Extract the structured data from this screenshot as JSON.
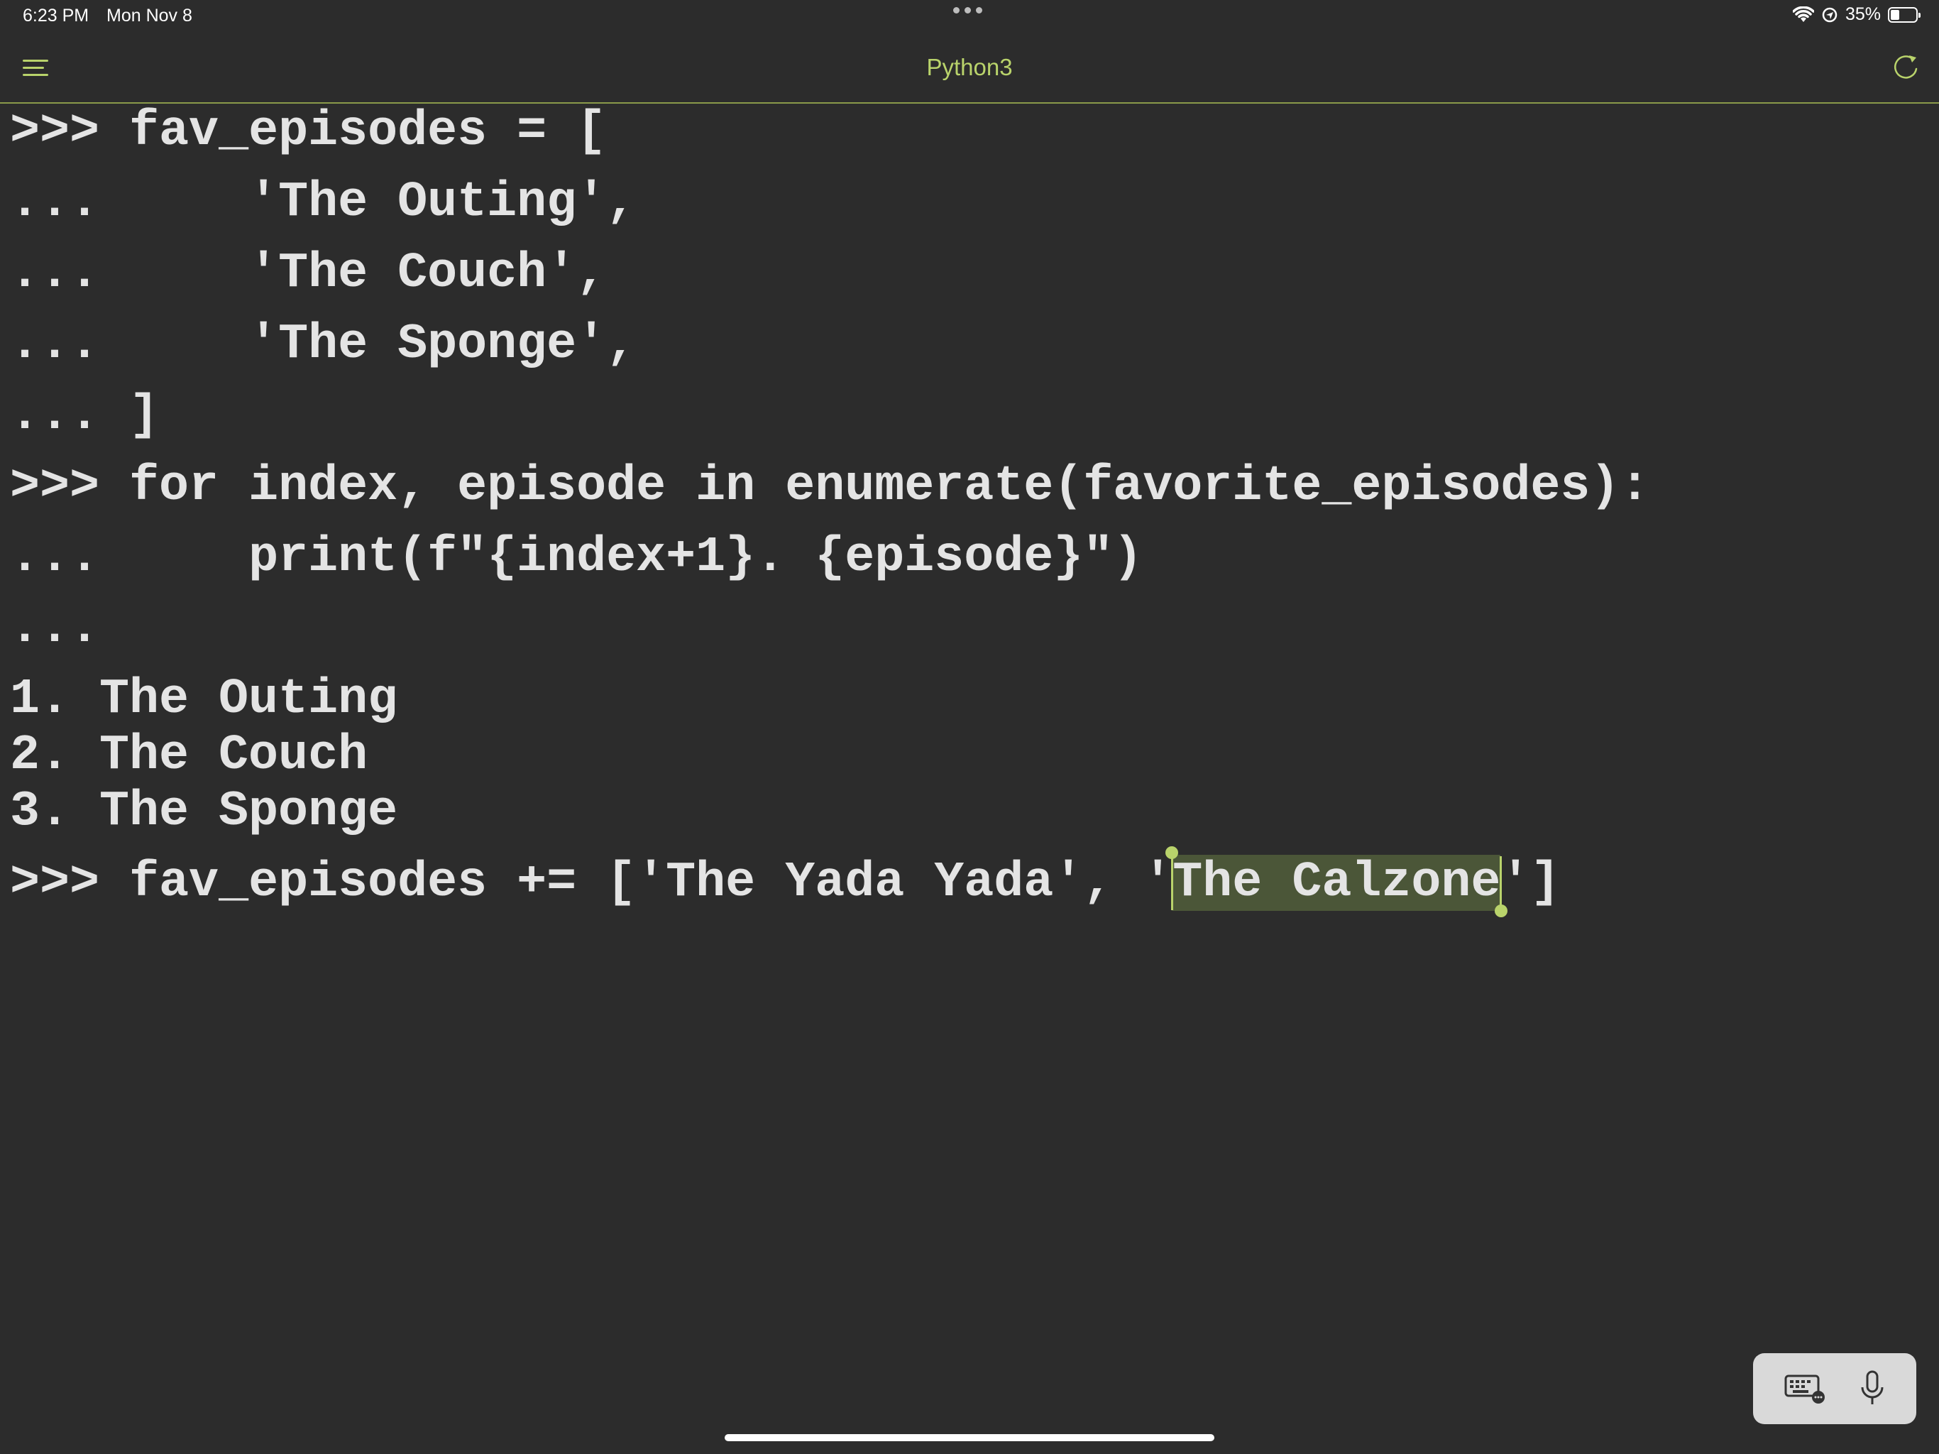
{
  "status_bar": {
    "time": "6:23 PM",
    "date": "Mon Nov 8",
    "battery_text": "35%",
    "battery_level": 0.35,
    "icons": [
      "wifi-icon",
      "location-icon",
      "battery-icon",
      "more-dots-icon"
    ]
  },
  "nav": {
    "title": "Python3",
    "menu_icon": "menu-icon",
    "refresh_icon": "refresh-icon",
    "accent_color": "#b9d36b"
  },
  "terminal": {
    "lines": [
      {
        "prompt": ">>>",
        "code": "fav_episodes = ["
      },
      {
        "prompt": "...",
        "code": "    'The Outing',"
      },
      {
        "prompt": "...",
        "code": "    'The Couch',"
      },
      {
        "prompt": "...",
        "code": "    'The Sponge',"
      },
      {
        "prompt": "...",
        "code": "]"
      },
      {
        "prompt": ">>>",
        "code": "for index, episode in enumerate(favorite_episodes):"
      },
      {
        "prompt": "...",
        "code": "    print(f\"{index+1}. {episode}\")"
      },
      {
        "prompt": "...",
        "code": ""
      }
    ],
    "output": [
      "1. The Outing",
      "2. The Couch",
      "3. The Sponge"
    ],
    "current_input": {
      "prompt": ">>>",
      "before_selection": "fav_episodes += ['The Yada Yada', '",
      "selection": "The Calzone",
      "after_selection": "']"
    },
    "text_color": "#e4e4e4",
    "background_color": "#2c2c2c",
    "selection_color": "#4b5638"
  },
  "keyboard_toolbar": {
    "icons": [
      "keyboard-icon",
      "microphone-icon"
    ]
  }
}
